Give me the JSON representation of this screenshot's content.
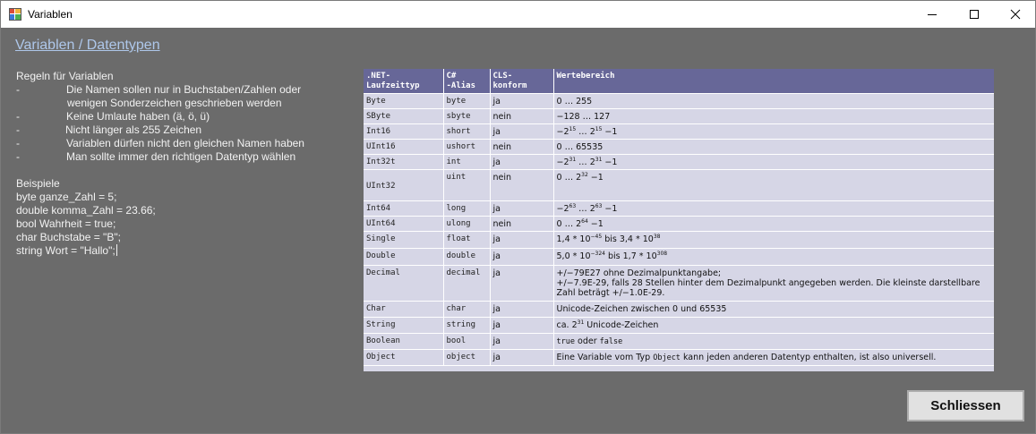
{
  "window": {
    "title": "Variablen"
  },
  "heading": "Variablen / Datentypen",
  "rules": {
    "title": "Regeln für Variablen",
    "dash": "-",
    "items": [
      "Die Namen sollen nur in Buchstaben/Zahlen oder",
      "wenigen Sonderzeichen geschrieben werden",
      "Keine Umlaute haben (ä, ö, ü)",
      "Nicht länger als 255 Zeichen",
      "Variablen dürfen nicht den gleichen Namen haben",
      "Man sollte immer den richtigen Datentyp wählen"
    ]
  },
  "examples": {
    "title": "Beispiele",
    "lines": [
      "byte ganze_Zahl = 5;",
      "double komma_Zahl = 23.66;",
      "bool Wahrheit = true;",
      "char Buchstabe = \"B\";",
      "string Wort = \"Hallo\";"
    ]
  },
  "table": {
    "headers": [
      ".NET-\nLaufzeittyp",
      "C#\n-Alias",
      "CLS-\nkonform",
      "Wertebereich"
    ],
    "rows": [
      {
        "net": "Byte",
        "alias": "byte",
        "cls": "ja"
      },
      {
        "net": "SByte",
        "alias": "sbyte",
        "cls": "nein"
      },
      {
        "net": "Int16",
        "alias": "short",
        "cls": "ja"
      },
      {
        "net": "UInt16",
        "alias": "ushort",
        "cls": "nein"
      },
      {
        "net": "Int32t",
        "alias": "int",
        "cls": "ja"
      },
      {
        "net": "UInt32",
        "alias": "uint",
        "cls": "nein"
      },
      {
        "net": "Int64",
        "alias": "long",
        "cls": "ja"
      },
      {
        "net": "UInt64",
        "alias": "ulong",
        "cls": "nein"
      },
      {
        "net": "Single",
        "alias": "float",
        "cls": "ja"
      },
      {
        "net": "Double",
        "alias": "double",
        "cls": "ja"
      },
      {
        "net": "Decimal",
        "alias": "decimal",
        "cls": "ja"
      },
      {
        "net": "Char",
        "alias": "char",
        "cls": "ja"
      },
      {
        "net": "String",
        "alias": "string",
        "cls": "ja"
      },
      {
        "net": "Boolean",
        "alias": "bool",
        "cls": "ja"
      },
      {
        "net": "Object",
        "alias": "object",
        "cls": "ja"
      }
    ],
    "ranges": {
      "byte": "0 … 255",
      "sbyte": "−128 … 127",
      "short_a": "−2",
      "short_e1": "15",
      "short_b": " … 2",
      "short_e2": "15",
      "short_c": " −1",
      "ushort": "0 … 65535",
      "int_a": "−2",
      "int_e1": "31",
      "int_b": " … 2",
      "int_e2": "31",
      "int_c": " −1",
      "uint_a": "0 … 2",
      "uint_e": "32",
      "uint_c": " −1",
      "long_a": "−2",
      "long_e1": "63",
      "long_b": " … 2",
      "long_e2": "63",
      "long_c": " −1",
      "ulong_a": "0 … 2",
      "ulong_e": "64",
      "ulong_c": " −1",
      "float_a": "1,4 * 10",
      "float_e1": "−45",
      "float_b": " bis 3,4 * 10",
      "float_e2": "38",
      "double_a": "5,0 * 10",
      "double_e1": "−324",
      "double_b": " bis 1,7 * 10",
      "double_e2": "308",
      "decimal_1": "+/−79E27 ohne Dezimalpunktangabe;",
      "decimal_2": "+/−7.9E-29, falls 28 Stellen hinter dem Dezimalpunkt angegeben werden. Die kleinste darstellbare Zahl beträgt +/−1.0E-29.",
      "char": "Unicode-Zeichen zwischen 0 und 65535",
      "string_a": "ca. 2",
      "string_e": "31",
      "string_b": " Unicode-Zeichen",
      "bool_true": "true",
      "bool_mid": " oder ",
      "bool_false": "false",
      "object_a": "Eine Variable vom Typ ",
      "object_code": "Object",
      "object_b": " kann jeden anderen Datentyp enthalten, ist also universell."
    }
  },
  "close_button": "Schliessen"
}
